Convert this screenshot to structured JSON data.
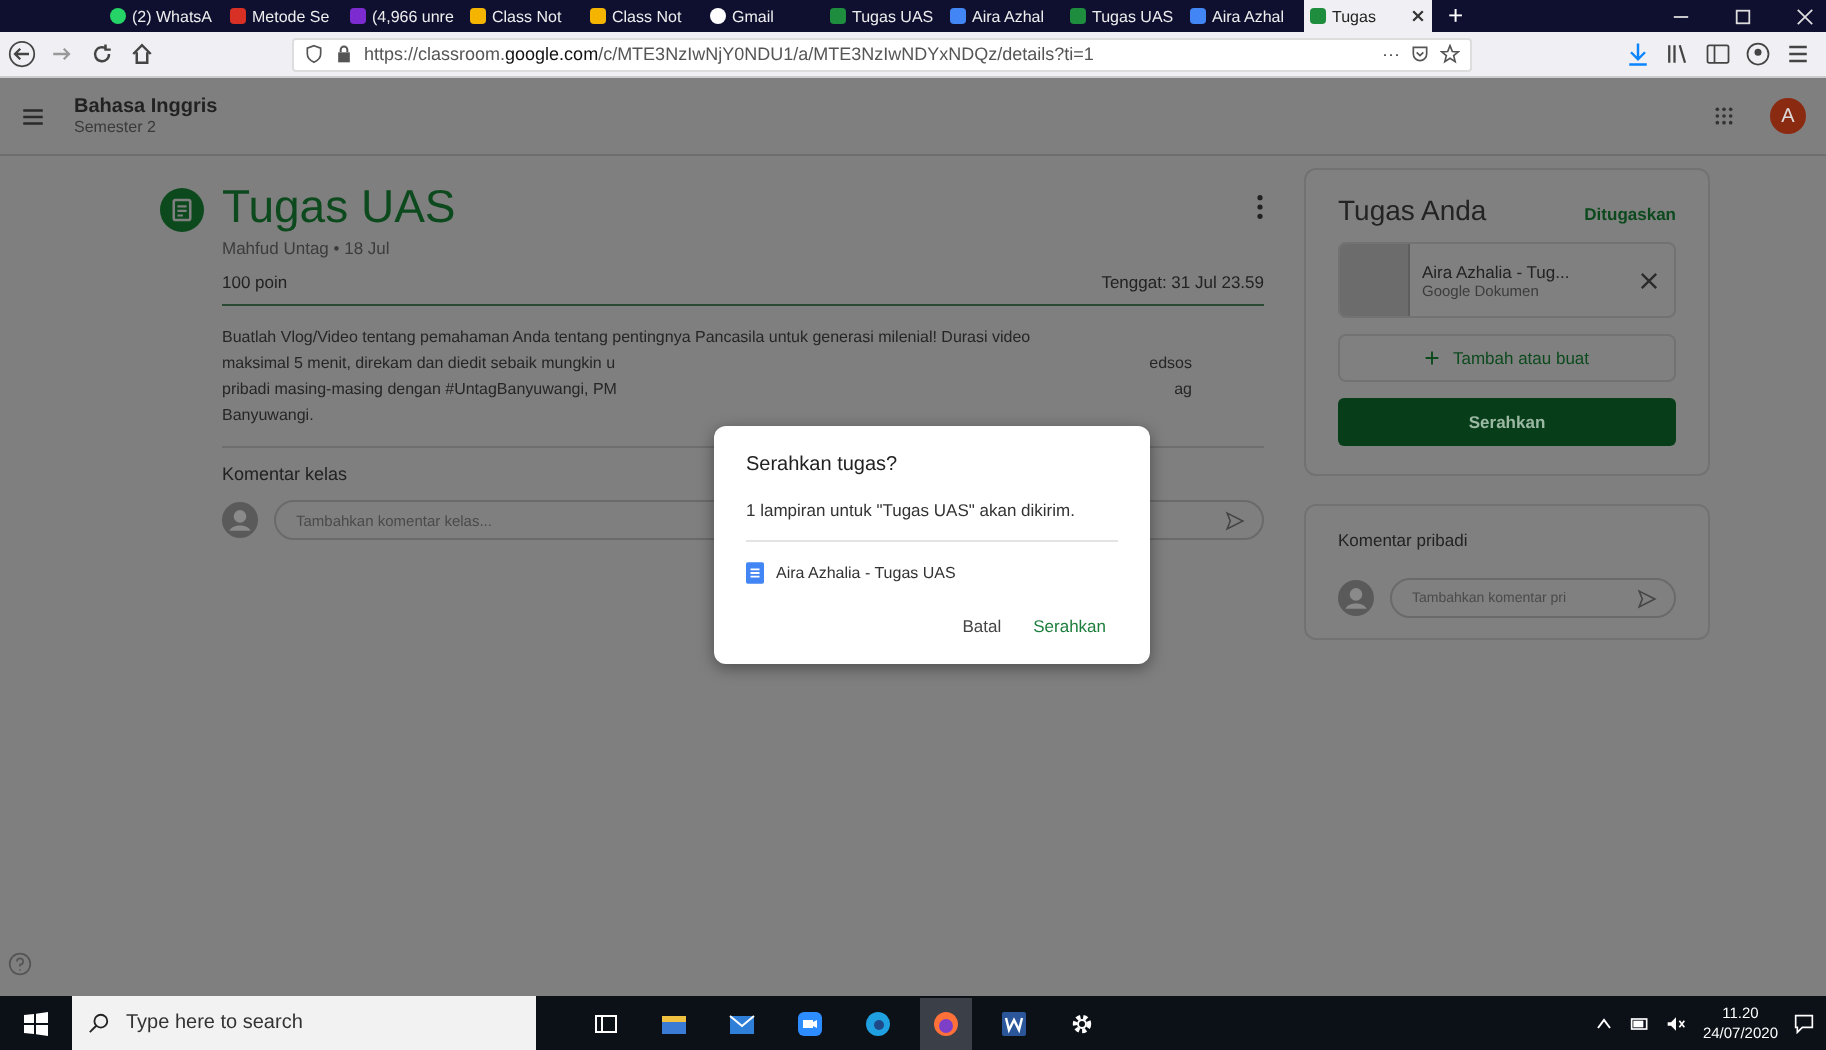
{
  "browser": {
    "tabs": [
      {
        "label": "(2) WhatsA",
        "selected": false
      },
      {
        "label": "Metode Se",
        "selected": false
      },
      {
        "label": "(4,966 unre",
        "selected": false
      },
      {
        "label": "Class Not",
        "selected": false
      },
      {
        "label": "Class Not",
        "selected": false
      },
      {
        "label": "Gmail",
        "selected": false
      },
      {
        "label": "Tugas UAS",
        "selected": false
      },
      {
        "label": "Aira Azhal",
        "selected": false
      },
      {
        "label": "Tugas UAS",
        "selected": false
      },
      {
        "label": "Aira Azhal",
        "selected": false
      },
      {
        "label": "Tugas",
        "selected": true
      }
    ],
    "new_tab": "+",
    "url_host_prefix": "https://classroom.",
    "url_domain": "google.com",
    "url_path": "/c/MTE3NzIwNjY0NDU1/a/MTE3NzIwNDYxNDQz/details?ti=1",
    "url_more": "···"
  },
  "header": {
    "title": "Bahasa Inggris",
    "subtitle": "Semester 2",
    "avatar": "A"
  },
  "assignment": {
    "title": "Tugas UAS",
    "meta": "Mahfud Untag • 18 Jul",
    "points": "100 poin",
    "due": "Tenggat: 31 Jul 23.59",
    "description_lines": [
      {
        "left": "Buatlah Vlog/Video tentang pemahaman Anda tentang pentingnya Pancasila untuk generasi milenial! Durasi video"
      },
      {
        "left": "maksimal 5 menit, direkam dan diedit sebaik mungkin u",
        "right": "edsos"
      },
      {
        "left": "pribadi masing-masing dengan  #UntagBanyuwangi, PM",
        "right": "ag"
      },
      {
        "left": "Banyuwangi."
      }
    ],
    "class_comments": {
      "label": "Komentar kelas",
      "placeholder": "Tambahkan komentar kelas..."
    }
  },
  "your_work": {
    "title": "Tugas Anda",
    "status": "Ditugaskan",
    "attachment": {
      "name": "Aira Azhalia - Tug...",
      "type": "Google Dokumen"
    },
    "add_button": "Tambah atau buat",
    "submit_button": "Serahkan"
  },
  "private_comments": {
    "label": "Komentar pribadi",
    "placeholder": "Tambahkan komentar pri"
  },
  "dialog": {
    "title": "Serahkan tugas?",
    "message": "1 lampiran untuk \"Tugas UAS\" akan dikirim.",
    "attachment": "Aira Azhalia - Tugas UAS",
    "cancel": "Batal",
    "confirm": "Serahkan"
  },
  "taskbar": {
    "search_placeholder": "Type here to search",
    "time": "11.20",
    "date": "24/07/2020"
  }
}
